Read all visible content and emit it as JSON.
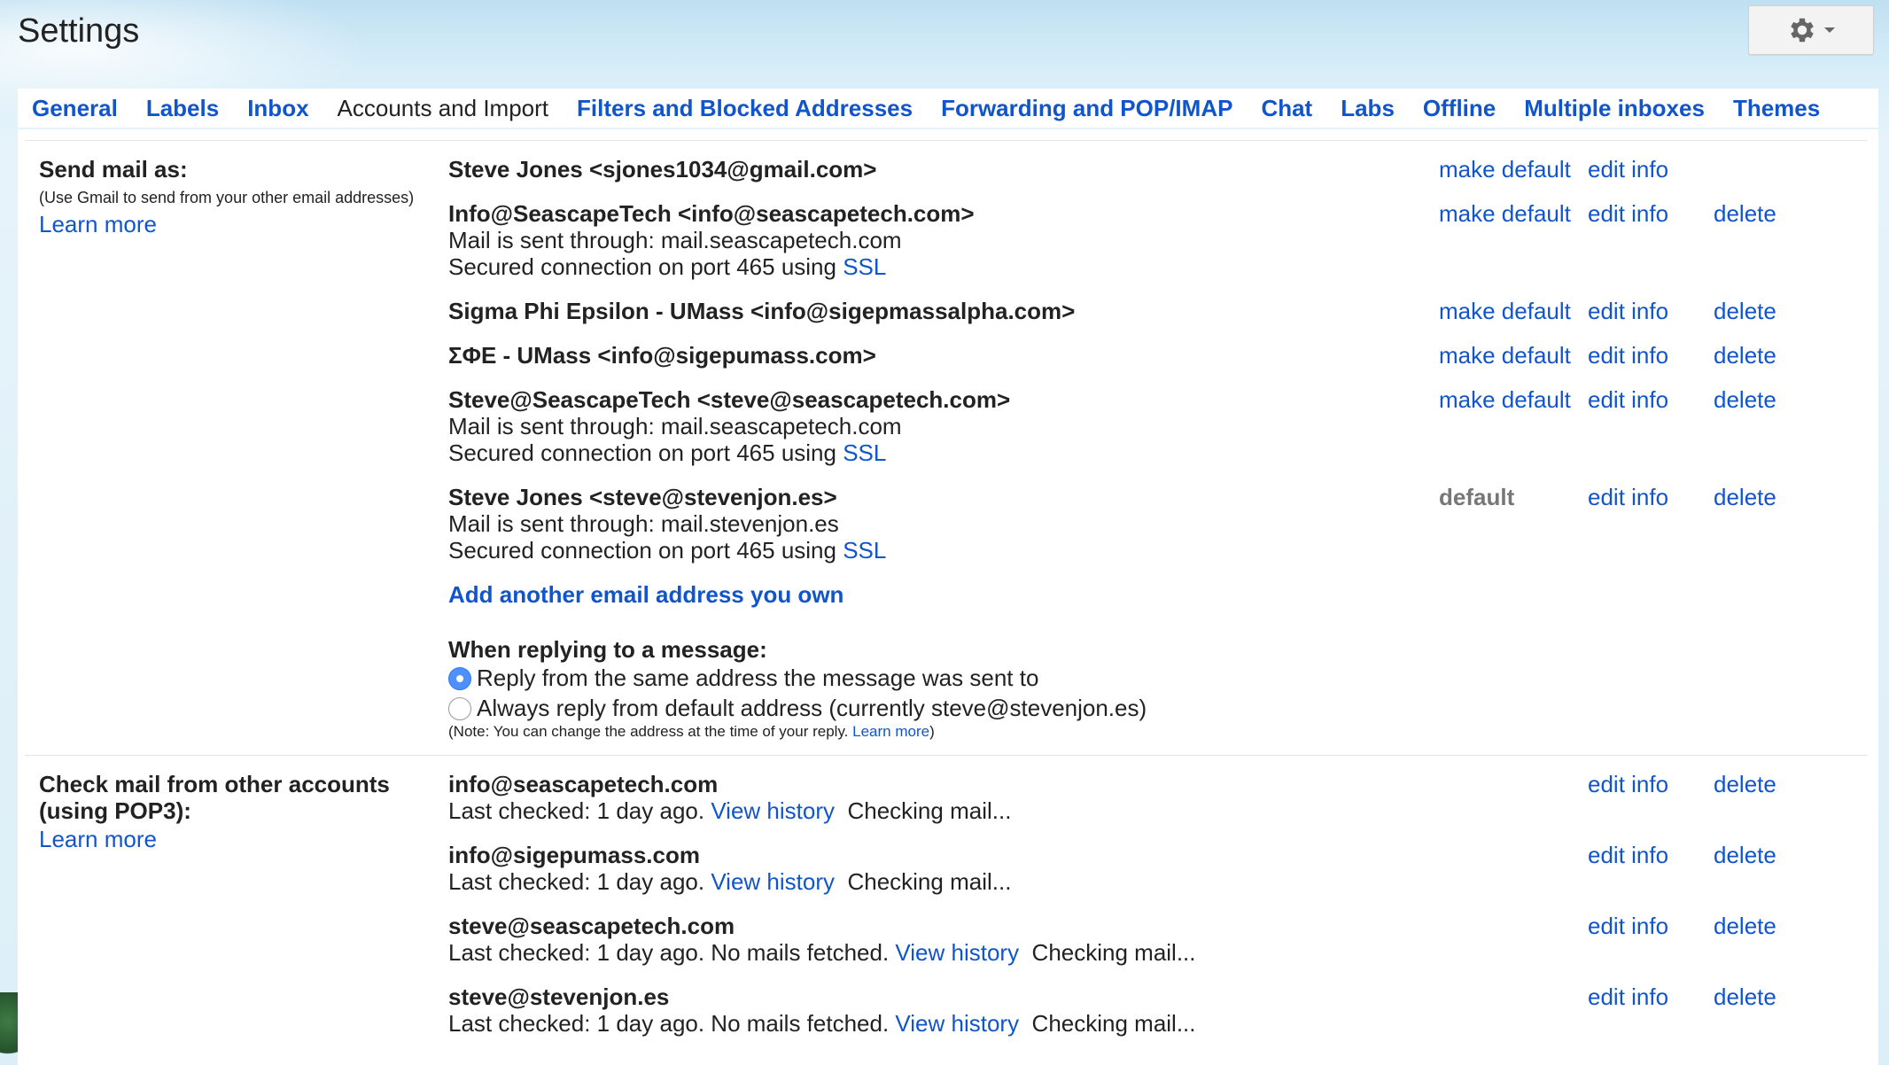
{
  "header": {
    "title": "Settings",
    "gear_icon": "gear-icon",
    "caret_icon": "caret-down-icon"
  },
  "tabs": [
    {
      "label": "General"
    },
    {
      "label": "Labels"
    },
    {
      "label": "Inbox"
    },
    {
      "label": "Accounts and Import",
      "active": true
    },
    {
      "label": "Filters and Blocked Addresses"
    },
    {
      "label": "Forwarding and POP/IMAP"
    },
    {
      "label": "Chat"
    },
    {
      "label": "Labs"
    },
    {
      "label": "Offline"
    },
    {
      "label": "Multiple inboxes"
    },
    {
      "label": "Themes"
    }
  ],
  "send_mail": {
    "title": "Send mail as:",
    "subtitle": "(Use Gmail to send from your other email addresses)",
    "learn_more": "Learn more",
    "accounts": [
      {
        "name": "Steve Jones <sjones1034@gmail.com>",
        "make_default": "make default",
        "edit": "edit info"
      },
      {
        "name": "Info@SeascapeTech <info@seascapetech.com>",
        "line1": "Mail is sent through: mail.seascapetech.com",
        "line2_prefix": "Secured connection on port 465 using ",
        "line2_link": "SSL",
        "make_default": "make default",
        "edit": "edit info",
        "delete": "delete"
      },
      {
        "name": "Sigma Phi Epsilon - UMass <info@sigepmassalpha.com>",
        "make_default": "make default",
        "edit": "edit info",
        "delete": "delete"
      },
      {
        "name": "ΣΦΕ - UMass <info@sigepumass.com>",
        "make_default": "make default",
        "edit": "edit info",
        "delete": "delete"
      },
      {
        "name": "Steve@SeascapeTech <steve@seascapetech.com>",
        "line1": "Mail is sent through: mail.seascapetech.com",
        "line2_prefix": "Secured connection on port 465 using ",
        "line2_link": "SSL",
        "make_default": "make default",
        "edit": "edit info",
        "delete": "delete"
      },
      {
        "name": "Steve Jones <steve@stevenjon.es>",
        "line1": "Mail is sent through: mail.stevenjon.es",
        "line2_prefix": "Secured connection on port 465 using ",
        "line2_link": "SSL",
        "default_label": "default",
        "edit": "edit info",
        "delete": "delete"
      }
    ],
    "add_another": "Add another email address you own",
    "reply_title": "When replying to a message:",
    "reply_option_same": "Reply from the same address the message was sent to",
    "reply_option_default": "Always reply from default address (currently steve@stevenjon.es)",
    "reply_selected": "same",
    "note_prefix": "(Note: You can change the address at the time of your reply. ",
    "note_link": "Learn more",
    "note_suffix": ")"
  },
  "check_mail": {
    "title_line1": "Check mail from other accounts",
    "title_line2": "(using POP3):",
    "learn_more": "Learn more",
    "accounts": [
      {
        "email": "info@seascapetech.com",
        "status_prefix": "Last checked: 1 day ago. ",
        "history": "View history",
        "checking": "Checking mail...",
        "edit": "edit info",
        "delete": "delete"
      },
      {
        "email": "info@sigepumass.com",
        "status_prefix": "Last checked: 1 day ago. ",
        "history": "View history",
        "checking": "Checking mail...",
        "edit": "edit info",
        "delete": "delete"
      },
      {
        "email": "steve@seascapetech.com",
        "status_prefix": "Last checked: 1 day ago. No mails fetched. ",
        "history": "View history",
        "checking": "Checking mail...",
        "edit": "edit info",
        "delete": "delete"
      },
      {
        "email": "steve@stevenjon.es",
        "status_prefix": "Last checked: 1 day ago. No mails fetched. ",
        "history": "View history",
        "checking": "Checking mail...",
        "edit": "edit info",
        "delete": "delete"
      }
    ]
  },
  "colors": {
    "link": "#1155cc",
    "text": "#222222",
    "default_label": "#777777",
    "radio_selected": "#4d90fe"
  }
}
